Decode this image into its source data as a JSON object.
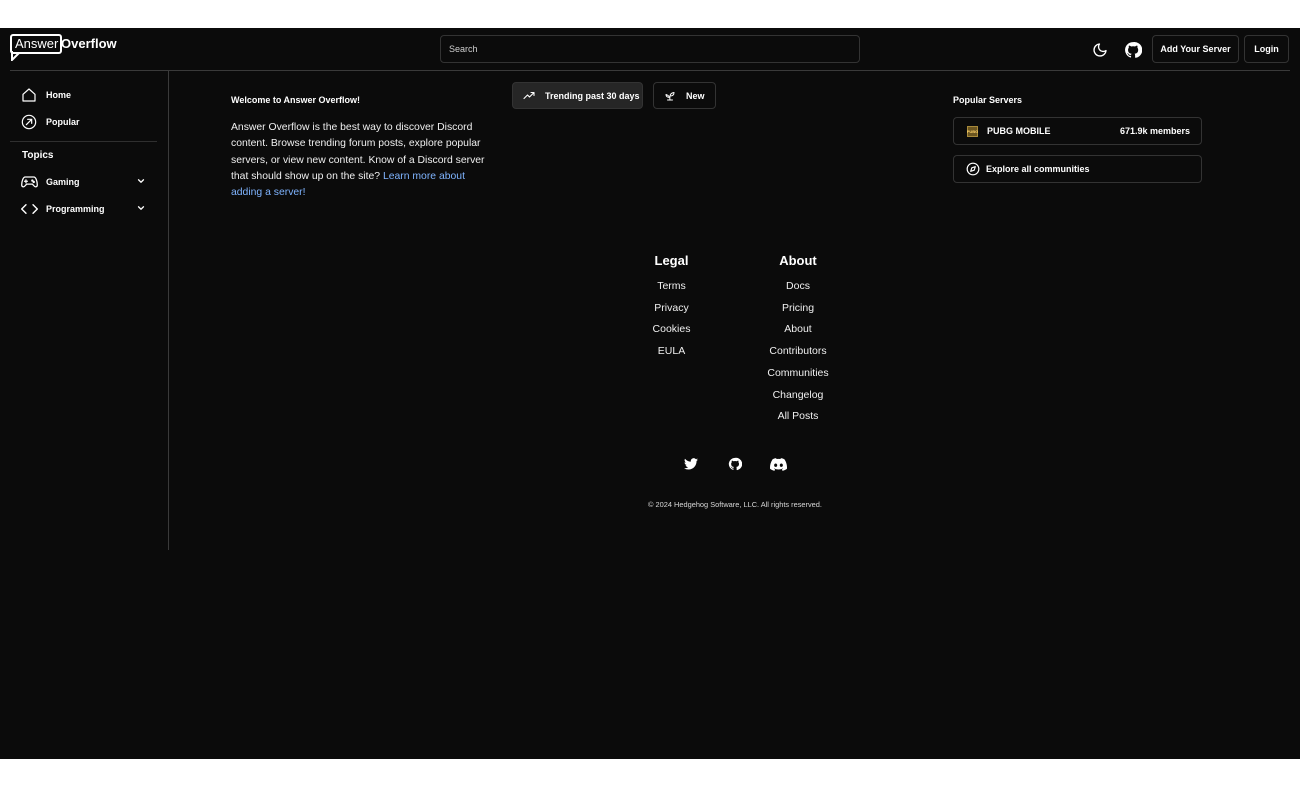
{
  "header": {
    "logo_word1": "Answer",
    "logo_word2": "Overflow",
    "search_placeholder": "Search",
    "theme_icon": "moon-icon",
    "github_icon": "github-icon",
    "add_server_label": "Add Your Server",
    "login_label": "Login"
  },
  "sidebar": {
    "items": [
      {
        "label": "Home",
        "icon": "home-icon"
      },
      {
        "label": "Popular",
        "icon": "trending-circle-icon"
      }
    ],
    "topics_heading": "Topics",
    "topics": [
      {
        "label": "Gaming",
        "icon": "gamepad-icon"
      },
      {
        "label": "Programming",
        "icon": "code-icon"
      }
    ]
  },
  "welcome": {
    "title": "Welcome to Answer Overflow!",
    "body": "Answer Overflow is the best way to discover Discord content. Browse trending forum posts, explore popular servers, or view new content. Know of a Discord server that should show up on the site? ",
    "link": "Learn more about adding a server!"
  },
  "tabs": [
    {
      "label": "Trending past 30 days",
      "icon": "trending-up-icon",
      "active": true
    },
    {
      "label": "New",
      "icon": "sprout-icon",
      "active": false
    }
  ],
  "popular_servers": {
    "heading": "Popular Servers",
    "servers": [
      {
        "name": "PUBG MOBILE",
        "members": "671.9k members"
      }
    ],
    "explore_label": "Explore all communities"
  },
  "footer": {
    "legal_heading": "Legal",
    "legal_links": [
      "Terms",
      "Privacy",
      "Cookies",
      "EULA"
    ],
    "about_heading": "About",
    "about_links": [
      "Docs",
      "Pricing",
      "About",
      "Contributors",
      "Communities",
      "Changelog",
      "All Posts"
    ],
    "social_icons": [
      "twitter-icon",
      "github-icon",
      "discord-icon"
    ],
    "copyright": "© 2024 Hedgehog Software, LLC. All rights reserved."
  },
  "colors": {
    "background": "#0b0b0b",
    "border": "#333333",
    "link": "#7fb4ff",
    "active_tab": "#262626"
  }
}
